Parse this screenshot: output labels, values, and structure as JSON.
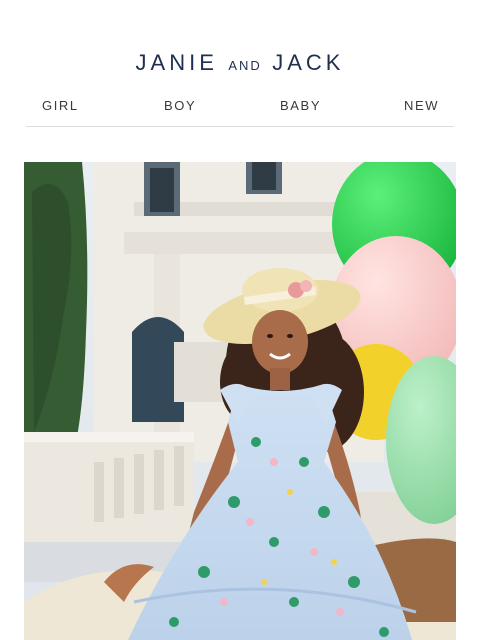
{
  "brand": {
    "left": "JANIE",
    "middle": "AND",
    "right": "JACK"
  },
  "nav": {
    "items": [
      "GIRL",
      "BOY",
      "BABY",
      "NEW"
    ]
  },
  "hero": {
    "image": "girl-in-floral-dress-with-balloons"
  }
}
